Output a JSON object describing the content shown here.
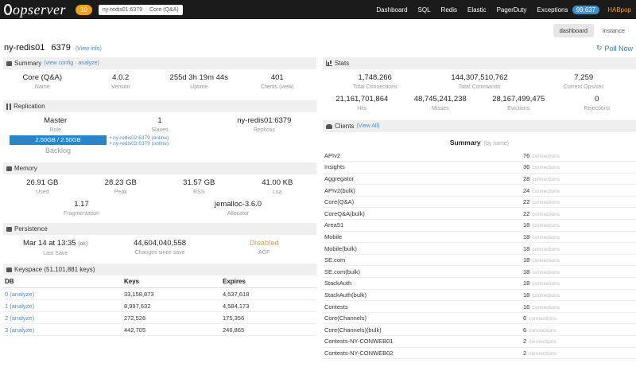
{
  "topbar": {
    "logo": "opserver",
    "alert_count": "10",
    "instance": {
      "name": "ny-redis01:6379",
      "role": "Core (Q&A)"
    },
    "nav": [
      "Dashboard",
      "SQL",
      "Redis",
      "Elastic",
      "PagerDuty",
      "Exceptions"
    ],
    "exceptions_count": "99,637",
    "user": "HABpop"
  },
  "tabs": [
    "dashboard",
    "instance"
  ],
  "title": {
    "host": "ny-redis01",
    "port": "6379",
    "view_info": "(View info)"
  },
  "refresh_label": "Poll Now",
  "summary": {
    "header": "Summary",
    "links": "(view config · analyze)",
    "items": [
      {
        "value": "Core (Q&A)",
        "label": "Name"
      },
      {
        "value": "4.0.2",
        "label": "Version"
      },
      {
        "value": "255d 3h 19m 44s",
        "label": "Uptime"
      },
      {
        "value": "401",
        "label": "Clients (view)"
      }
    ]
  },
  "replication": {
    "header": "Replication",
    "items": [
      {
        "value": "Master",
        "label": "Role"
      },
      {
        "value": "1",
        "label": "Slaves"
      },
      {
        "value": "ny-redis01:6379",
        "label": "Replicas"
      }
    ],
    "bar_label": "2.50GB / 2.50GB",
    "bar_caption": "Backlog",
    "side_lines": [
      "• ny-redis02:6379 (online)",
      "• ny-redis03:6379 (online)"
    ]
  },
  "memory": {
    "header": "Memory",
    "row1": [
      {
        "value": "26.91 GB",
        "label": "Used"
      },
      {
        "value": "28.23 GB",
        "label": "Peak"
      },
      {
        "value": "31.57 GB",
        "label": "RSS"
      },
      {
        "value": "41.00 KB",
        "label": "Lua"
      }
    ],
    "row2": [
      {
        "value": "1.17",
        "label": "Fragmentation"
      },
      {
        "value": "jemalloc-3.6.0",
        "label": "Allocator"
      }
    ]
  },
  "persistence": {
    "header": "Persistence",
    "items": [
      {
        "value": "Mar 14 at 13:35",
        "value_suffix": "(ok)",
        "label": "Last Save"
      },
      {
        "value": "44,604,040,558",
        "label": "Changes since save"
      },
      {
        "value": "Disabled",
        "label": "AOF"
      }
    ]
  },
  "keyspace": {
    "header": "Keyspace (51,101,881 keys)",
    "columns": [
      "DB",
      "Keys",
      "Expires"
    ],
    "rows": [
      {
        "db": "0 (analyze)",
        "keys": "33,158,873",
        "expires": "4,537,618"
      },
      {
        "db": "1 (analyze)",
        "keys": "8,997,632",
        "expires": "4,584,173"
      },
      {
        "db": "2 (analyze)",
        "keys": "272,526",
        "expires": "175,356"
      },
      {
        "db": "3 (analyze)",
        "keys": "442,705",
        "expires": "246,865"
      }
    ]
  },
  "stats": {
    "header": "Stats",
    "row1": [
      {
        "value": "1,748,266",
        "label": "Total Connections"
      },
      {
        "value": "144,307,510,762",
        "label": "Total Commands"
      },
      {
        "value": "7,259",
        "label": "Current Ops/sec"
      }
    ],
    "row2": [
      {
        "value": "21,161,701,864",
        "label": "Hits"
      },
      {
        "value": "48,745,241,238",
        "label": "Misses"
      },
      {
        "value": "28,167,499,475",
        "label": "Evictions"
      },
      {
        "value": "0",
        "label": "Rejections"
      }
    ]
  },
  "clients": {
    "header": "Clients",
    "header_link": "(View All)",
    "summary_title": "Summary",
    "summary_sub": "(by name)",
    "rows": [
      {
        "name": "APIv2",
        "count": "76",
        "sub": "connections"
      },
      {
        "name": "Insights",
        "count": "36",
        "sub": "connections"
      },
      {
        "name": "Aggregator",
        "count": "28",
        "sub": "connections"
      },
      {
        "name": "APIv2(bulk)",
        "count": "24",
        "sub": "connections"
      },
      {
        "name": "Core(Q&A)",
        "count": "22",
        "sub": "connections"
      },
      {
        "name": "CoreQ&A(bulk)",
        "count": "22",
        "sub": "connections"
      },
      {
        "name": "Area51",
        "count": "18",
        "sub": "connections"
      },
      {
        "name": "Mobile",
        "count": "18",
        "sub": "connections"
      },
      {
        "name": "Mobile(bulk)",
        "count": "18",
        "sub": "connections"
      },
      {
        "name": "SE.com",
        "count": "18",
        "sub": "connections"
      },
      {
        "name": "SE.com(bulk)",
        "count": "18",
        "sub": "connections"
      },
      {
        "name": "StackAuth",
        "count": "18",
        "sub": "connections"
      },
      {
        "name": "StackAuth(bulk)",
        "count": "18",
        "sub": "connections"
      },
      {
        "name": "Contests",
        "count": "16",
        "sub": "connections"
      },
      {
        "name": "Core(Channels)",
        "count": "6",
        "sub": "connections"
      },
      {
        "name": "Core(Channels)(bulk)",
        "count": "6",
        "sub": "connections"
      },
      {
        "name": "Contests-NY-CONWEB01",
        "count": "2",
        "sub": "connections"
      },
      {
        "name": "Contests-NY-CONWEB02",
        "count": "2",
        "sub": "connections"
      }
    ]
  }
}
